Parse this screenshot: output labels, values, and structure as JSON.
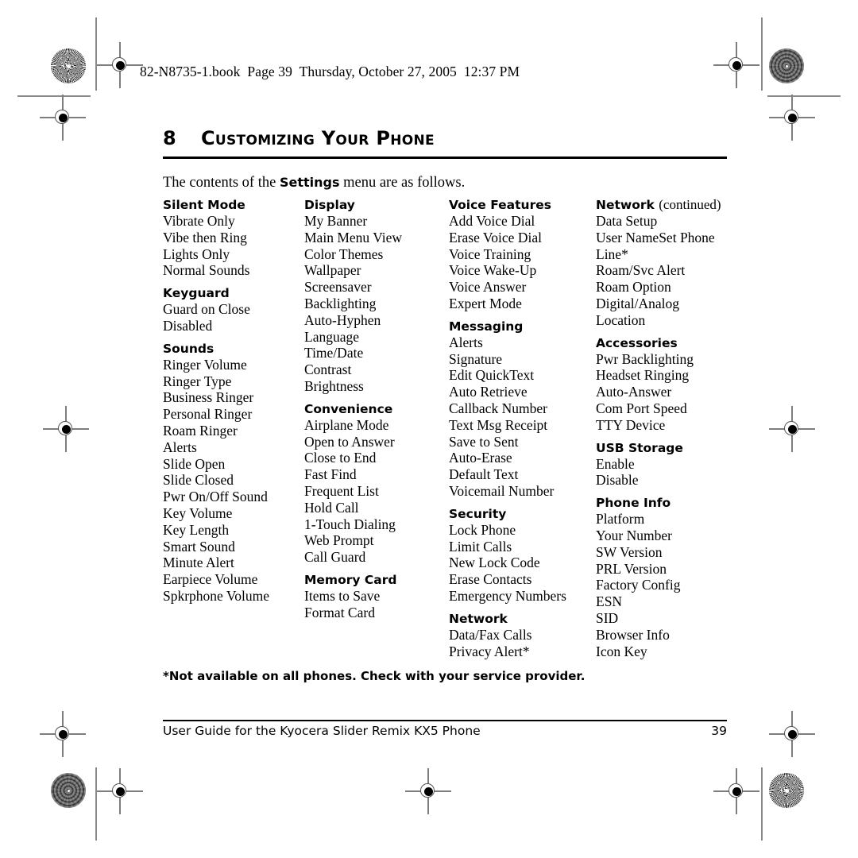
{
  "print_header": "82-N8735-1.book  Page 39  Thursday, October 27, 2005  12:37 PM",
  "chapter": {
    "number": "8",
    "title": "Customizing Your Phone"
  },
  "intro": {
    "before": "The contents of the ",
    "bold": "Settings",
    "after": " menu are as follows."
  },
  "columns": [
    {
      "groups": [
        {
          "heading": "Silent Mode",
          "items": [
            "Vibrate Only",
            "Vibe then Ring",
            "Lights Only",
            "Normal Sounds"
          ]
        },
        {
          "heading": "Keyguard",
          "items": [
            "Guard on Close",
            "Disabled"
          ]
        },
        {
          "heading": "Sounds",
          "items": [
            "Ringer Volume",
            "Ringer Type",
            "Business Ringer",
            "Personal Ringer",
            "Roam Ringer",
            "Alerts",
            "Slide Open",
            "Slide Closed",
            "Pwr On/Off Sound",
            "Key Volume",
            "Key Length",
            "Smart Sound",
            "Minute Alert",
            "Earpiece Volume",
            "Spkrphone Volume"
          ]
        }
      ]
    },
    {
      "groups": [
        {
          "heading": "Display",
          "items": [
            "My Banner",
            "Main Menu View",
            "Color Themes",
            "Wallpaper",
            "Screensaver",
            "Backlighting",
            "Auto-Hyphen",
            "Language",
            "Time/Date",
            "Contrast",
            "Brightness"
          ]
        },
        {
          "heading": "Convenience",
          "items": [
            "Airplane Mode",
            "Open to Answer",
            "Close to End",
            "Fast Find",
            "Frequent List",
            "Hold Call",
            "1-Touch Dialing",
            "Web Prompt",
            "Call Guard"
          ]
        },
        {
          "heading": "Memory Card",
          "items": [
            "Items to Save",
            "Format Card"
          ]
        }
      ]
    },
    {
      "groups": [
        {
          "heading": "Voice Features",
          "items": [
            "Add Voice Dial",
            "Erase Voice Dial",
            "Voice Training",
            "Voice Wake-Up",
            "Voice Answer",
            "Expert Mode"
          ]
        },
        {
          "heading": "Messaging",
          "items": [
            "Alerts",
            "Signature",
            "Edit QuickText",
            "Auto Retrieve",
            "Callback Number",
            "Text Msg Receipt",
            "Save to Sent",
            "Auto-Erase",
            "Default Text",
            "Voicemail Number"
          ]
        },
        {
          "heading": "Security",
          "items": [
            "Lock Phone",
            "Limit Calls",
            "New Lock Code",
            "Erase Contacts",
            "Emergency Numbers"
          ]
        },
        {
          "heading": "Network",
          "items": [
            "Data/Fax Calls",
            "Privacy Alert*"
          ]
        }
      ]
    },
    {
      "groups": [
        {
          "heading": "Network",
          "heading_suffix": "(continued)",
          "items": [
            "Data Setup",
            "User NameSet Phone",
            "Line*",
            "Roam/Svc Alert",
            "Roam Option",
            "Digital/Analog",
            "Location"
          ]
        },
        {
          "heading": "Accessories",
          "items": [
            "Pwr Backlighting",
            "Headset Ringing",
            "Auto-Answer",
            "Com Port Speed",
            "TTY Device"
          ]
        },
        {
          "heading": "USB Storage",
          "items": [
            "Enable",
            "Disable"
          ]
        },
        {
          "heading": "Phone Info",
          "items": [
            "Platform",
            "Your Number",
            "SW Version",
            "PRL Version",
            "Factory Config",
            "ESN",
            "SID",
            "Browser Info",
            "Icon Key"
          ]
        }
      ]
    }
  ],
  "footnote": "*Not available on all phones. Check with your service provider.",
  "footer": {
    "text": "User Guide for the Kyocera Slider Remix KX5 Phone",
    "page": "39"
  },
  "colors": {
    "text": "#000000",
    "mark": "#8a8a8a"
  }
}
